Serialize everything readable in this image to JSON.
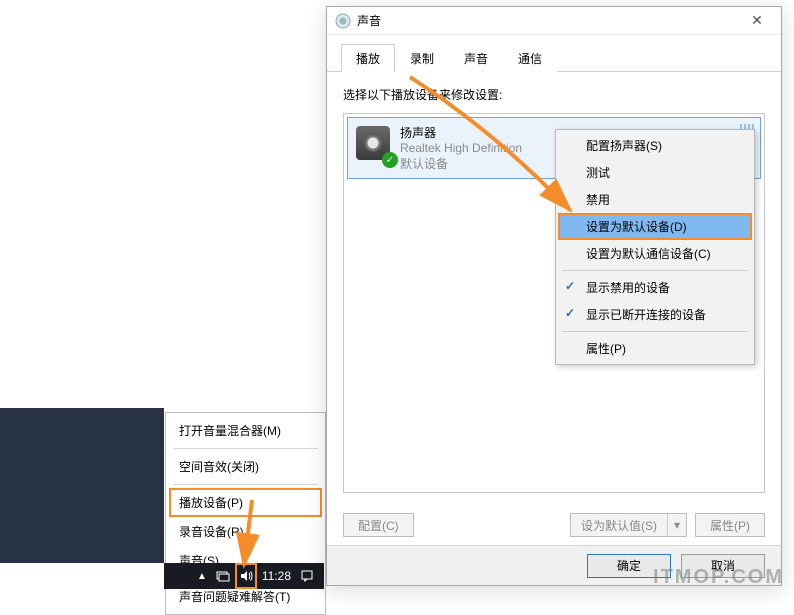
{
  "dialog": {
    "title": "声音",
    "tabs": [
      "播放",
      "录制",
      "声音",
      "通信"
    ],
    "active_tab": 0,
    "instruction": "选择以下播放设备来修改设置:",
    "device": {
      "name": "扬声器",
      "desc": "Realtek High Definition",
      "status": "默认设备"
    },
    "buttons": {
      "configure": "配置(C)",
      "set_default": "设为默认值(S)",
      "properties": "属性(P)"
    },
    "footer": {
      "ok": "确定",
      "cancel": "取消"
    }
  },
  "context_menu": {
    "items": [
      {
        "label": "配置扬声器(S)",
        "type": "normal"
      },
      {
        "label": "测试",
        "type": "normal"
      },
      {
        "label": "禁用",
        "type": "normal"
      },
      {
        "label": "设置为默认设备(D)",
        "type": "highlight"
      },
      {
        "label": "设置为默认通信设备(C)",
        "type": "normal"
      },
      {
        "label": "显示禁用的设备",
        "type": "checked"
      },
      {
        "label": "显示已断开连接的设备",
        "type": "checked"
      },
      {
        "label": "属性(P)",
        "type": "normal"
      }
    ]
  },
  "tray_menu": {
    "items": [
      {
        "label": "打开音量混合器(M)"
      },
      {
        "label": "空间音效(关闭)"
      },
      {
        "label": "播放设备(P)",
        "highlight": true
      },
      {
        "label": "录音设备(R)"
      },
      {
        "label": "声音(S)"
      },
      {
        "label": "声音问题疑难解答(T)"
      }
    ]
  },
  "taskbar": {
    "time": "11:28"
  },
  "watermark": "ITMOP.COM"
}
